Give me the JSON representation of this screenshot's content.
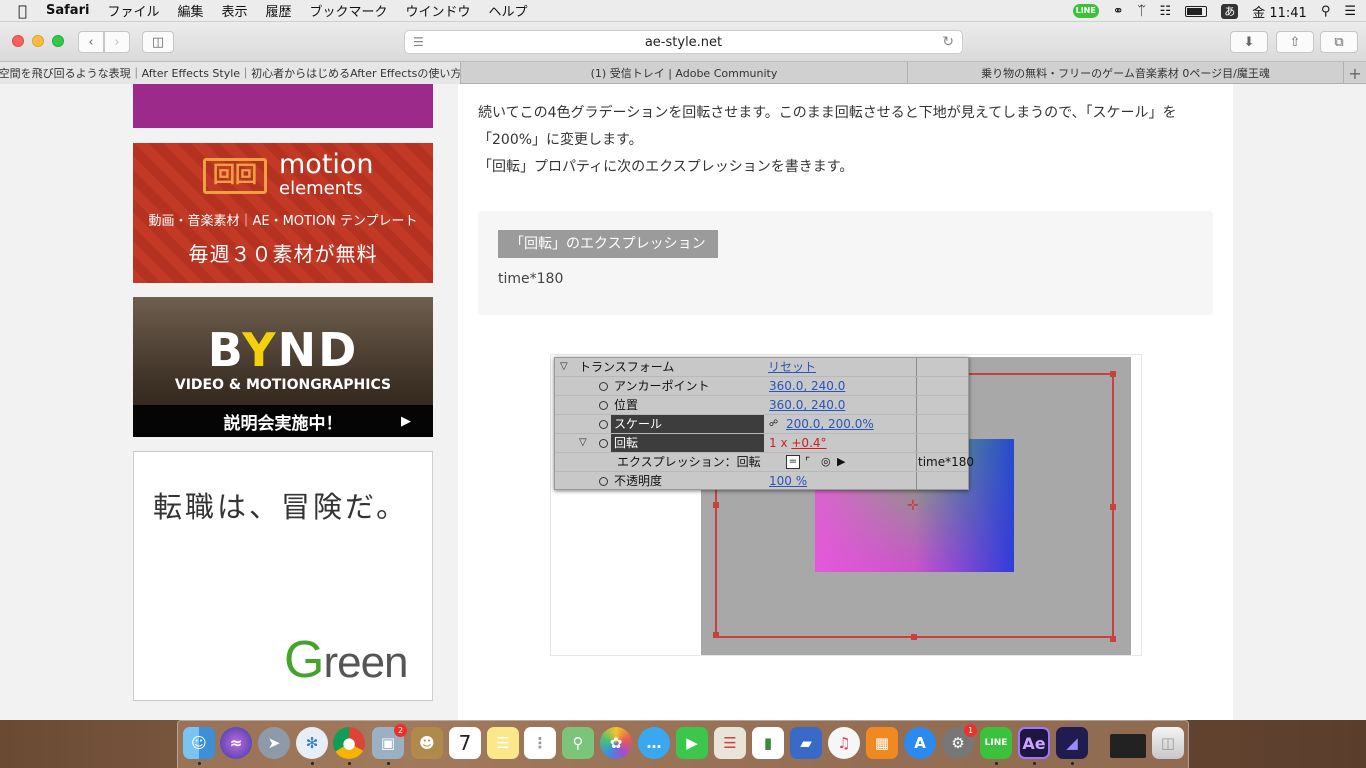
{
  "menubar": {
    "app": "Safari",
    "items": [
      "ファイル",
      "編集",
      "表示",
      "履歴",
      "ブックマーク",
      "ウインドウ",
      "ヘルプ"
    ],
    "line_badge": "LINE",
    "input_method": "あ",
    "clock": "金 11:41"
  },
  "browser": {
    "url": "ae-style.net",
    "tabs": [
      {
        "label": "空間を飛び回るような表現｜After Effects Style｜初心者からはじめるAfter Effectsの使い方"
      },
      {
        "label": "(1) 受信トレイ | Adobe Community"
      },
      {
        "label": "乗り物の無料・フリーのゲーム音楽素材 0ページ目/魔王魂"
      }
    ]
  },
  "ads": {
    "motion": {
      "brand_1": "motion",
      "brand_2": "elements",
      "line1": "動画・音楽素材｜AE・MOTION テンプレート",
      "line2": "毎週３０素材が無料"
    },
    "bynd": {
      "b": "B",
      "y": "Y",
      "nd": "ND",
      "sub": "VIDEO & MOTIONGRAPHICS",
      "cta": "説明会実施中！"
    },
    "green": {
      "headline": "転職は、冒険だ。",
      "logo_g": "G",
      "logo_rest": "reen"
    }
  },
  "article": {
    "para1": "続いてこの4色グラデーションを回転させます。このまま回転させると下地が見えてしまうので、「スケール」を「200%」に変更します。",
    "para2": "「回転」プロパティに次のエクスプレッションを書きます。",
    "code_label": "「回転」のエクスプレッション",
    "code": "time*180"
  },
  "ae_panel": {
    "rows": [
      {
        "name": "トランスフォーム",
        "value": "リセット"
      },
      {
        "name": "アンカーポイント",
        "value": "360.0, 240.0"
      },
      {
        "name": "位置",
        "value": "360.0, 240.0"
      },
      {
        "name": "スケール",
        "value": "200.0, 200.0%"
      },
      {
        "name": "回転",
        "value_a": "1 x ",
        "value_b": "+0.4°"
      },
      {
        "name": "エクスプレッション：回転",
        "value": "time*180"
      },
      {
        "name": "不透明度",
        "value": "100 %"
      }
    ],
    "expr_equals": "="
  },
  "dock": {
    "calendar_day": "7",
    "badge_preview": "2",
    "badge_prefs": "1",
    "ae_label": "Ae"
  }
}
